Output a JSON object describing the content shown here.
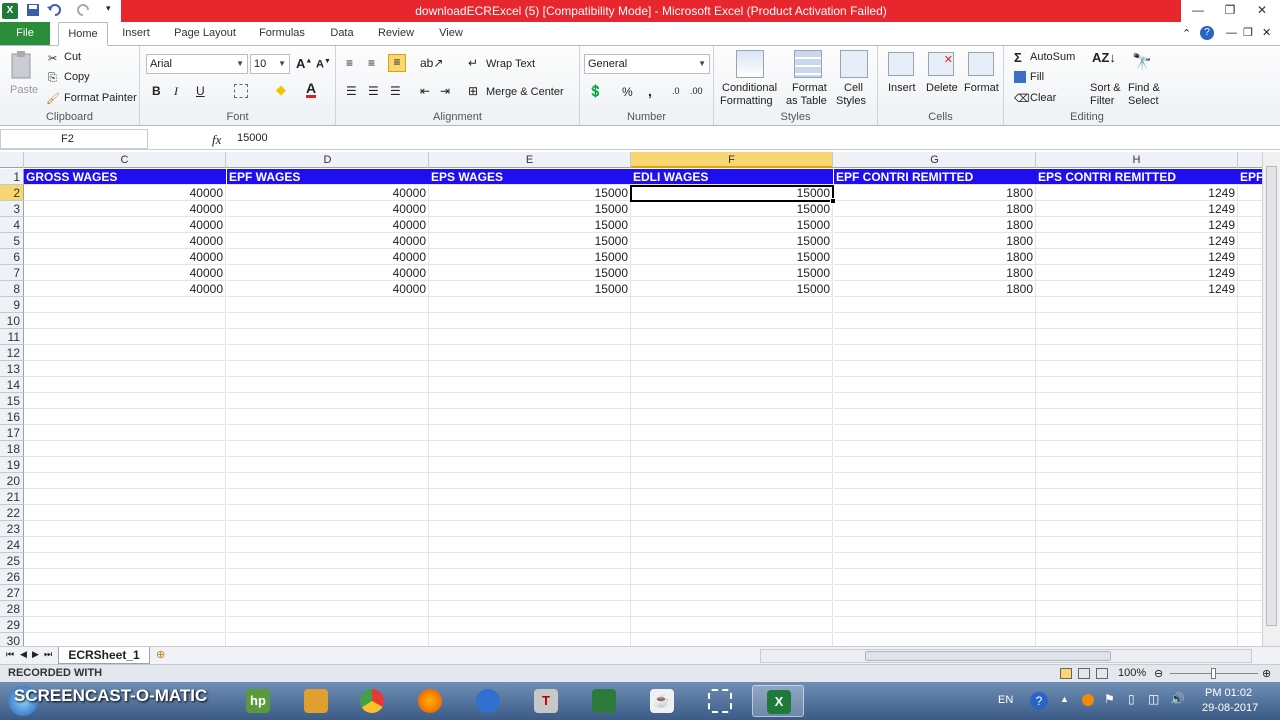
{
  "window": {
    "title": "downloadECRExcel (5)  [Compatibility Mode]  -  Microsoft Excel (Product Activation Failed)"
  },
  "tabs": [
    "File",
    "Home",
    "Insert",
    "Page Layout",
    "Formulas",
    "Data",
    "Review",
    "View"
  ],
  "active_tab": "Home",
  "ribbon": {
    "clipboard": {
      "paste": "Paste",
      "cut": "Cut",
      "copy": "Copy",
      "format_painter": "Format Painter",
      "label": "Clipboard"
    },
    "font": {
      "name": "Arial",
      "size": "10",
      "bold": "B",
      "italic": "I",
      "underline": "U",
      "label": "Font"
    },
    "alignment": {
      "wrap_text": "Wrap Text",
      "merge_center": "Merge & Center",
      "label": "Alignment"
    },
    "number": {
      "format": "General",
      "percent": "%",
      "comma": ",",
      "label": "Number"
    },
    "styles": {
      "conditional": "Conditional",
      "conditional2": "Formatting",
      "format_table": "Format",
      "format_table2": "as Table",
      "cell_styles": "Cell",
      "cell_styles2": "Styles",
      "label": "Styles"
    },
    "cells": {
      "insert": "Insert",
      "delete": "Delete",
      "format": "Format",
      "label": "Cells"
    },
    "editing": {
      "autosum": "AutoSum",
      "fill": "Fill",
      "clear": "Clear",
      "sort": "Sort &",
      "sort2": "Filter",
      "find": "Find &",
      "find2": "Select",
      "label": "Editing"
    }
  },
  "formula_bar": {
    "name_box": "F2",
    "fx": "fx",
    "value": "15000"
  },
  "columns": [
    "C",
    "D",
    "E",
    "F",
    "G",
    "H"
  ],
  "selected_column": "F",
  "header_row": [
    "GROSS WAGES",
    "EPF WAGES",
    "EPS WAGES",
    "EDLI WAGES",
    "EPF CONTRI REMITTED",
    "EPS CONTRI REMITTED",
    "EPF"
  ],
  "data_rows": [
    [
      "40000",
      "40000",
      "15000",
      "15000",
      "1800",
      "1249"
    ],
    [
      "40000",
      "40000",
      "15000",
      "15000",
      "1800",
      "1249"
    ],
    [
      "40000",
      "40000",
      "15000",
      "15000",
      "1800",
      "1249"
    ],
    [
      "40000",
      "40000",
      "15000",
      "15000",
      "1800",
      "1249"
    ],
    [
      "40000",
      "40000",
      "15000",
      "15000",
      "1800",
      "1249"
    ],
    [
      "40000",
      "40000",
      "15000",
      "15000",
      "1800",
      "1249"
    ],
    [
      "40000",
      "40000",
      "15000",
      "15000",
      "1800",
      "1249"
    ]
  ],
  "row_numbers": [
    "1",
    "2",
    "3",
    "4",
    "5",
    "6",
    "7",
    "8",
    "9",
    "10",
    "11",
    "12",
    "13",
    "14",
    "15",
    "16",
    "17",
    "18",
    "19",
    "20",
    "21",
    "22",
    "23",
    "24",
    "25",
    "26",
    "27",
    "28",
    "29",
    "30"
  ],
  "selected_row": "2",
  "sheet_tab": "ECRSheet_1",
  "status": {
    "recorded_with": "RECORDED WITH",
    "zoom": "100%"
  },
  "watermark": "SCREENCAST-O-MATIC",
  "taskbar": {
    "lang": "EN",
    "time": "PM 01:02",
    "date": "29-08-2017"
  },
  "colors": {
    "header_fill": "#1f0ef0",
    "title_red": "#e8262e",
    "file_tab": "#2a8d3a",
    "selection": "#f8d772"
  }
}
